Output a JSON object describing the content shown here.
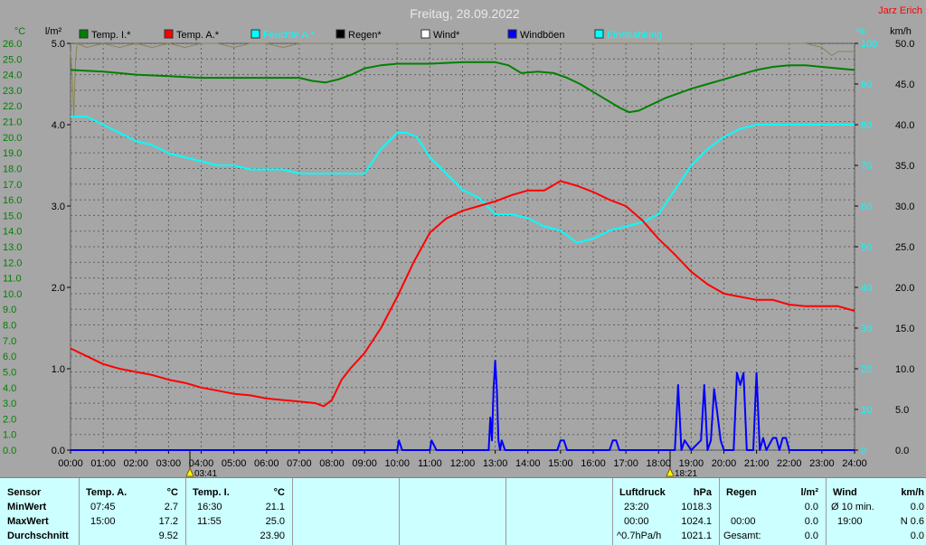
{
  "header": {
    "title": "Freitag, 28.09.2022",
    "author": "Jarz Erich"
  },
  "axes": {
    "left_temp_unit": "°C",
    "left_rain_unit": "l/m²",
    "right_hum_unit": "%",
    "right_wind_unit": "km/h",
    "temp_ticks": [
      "0.0",
      "1.0",
      "2.0",
      "3.0",
      "4.0",
      "5.0",
      "6.0",
      "7.0",
      "8.0",
      "9.0",
      "10.0",
      "11.0",
      "12.0",
      "13.0",
      "14.0",
      "15.0",
      "16.0",
      "17.0",
      "18.0",
      "19.0",
      "20.0",
      "21.0",
      "22.0",
      "23.0",
      "24.0",
      "25.0",
      "26.0"
    ],
    "rain_ticks": [
      "0.0",
      "1.0",
      "2.0",
      "3.0",
      "4.0",
      "5.0"
    ],
    "hum_ticks": [
      "0",
      "10",
      "20",
      "30",
      "40",
      "50",
      "60",
      "70",
      "80",
      "90",
      "100"
    ],
    "wind_ticks": [
      "0.0",
      "5.0",
      "10.0",
      "15.0",
      "20.0",
      "25.0",
      "30.0",
      "35.0",
      "40.0",
      "45.0",
      "50.0"
    ],
    "time_ticks": [
      "00:00",
      "01:00",
      "02:00",
      "03:00",
      "04:00",
      "05:00",
      "06:00",
      "07:00",
      "08:00",
      "09:00",
      "10:00",
      "11:00",
      "12:00",
      "13:00",
      "14:00",
      "15:00",
      "16:00",
      "17:00",
      "18:00",
      "19:00",
      "20:00",
      "21:00",
      "22:00",
      "23:00",
      "24:00"
    ],
    "sunrise": "03:41",
    "sunset": "18:21"
  },
  "legend": [
    {
      "label": "Temp. I.*",
      "color": "#008000"
    },
    {
      "label": "Temp. A.*",
      "color": "#ff0000"
    },
    {
      "label": "Feuchte A.*",
      "color": "#00ffff"
    },
    {
      "label": "Regen*",
      "color": "#000000"
    },
    {
      "label": "Wind*",
      "color": "#ffffff"
    },
    {
      "label": "Windböen",
      "color": "#0000ff"
    },
    {
      "label": "Einstrahlung",
      "color": "#00ffff"
    }
  ],
  "chart_data": {
    "type": "line",
    "title": "Freitag, 28.09.2022",
    "xlabel": "",
    "x_range": [
      0,
      24
    ],
    "temp_range": [
      0,
      26
    ],
    "rain_range": [
      0,
      5
    ],
    "hum_range": [
      0,
      100
    ],
    "wind_range": [
      0,
      50
    ],
    "grid": true,
    "legend_position": "top",
    "series": [
      {
        "name": "Temp. I.*",
        "axis": "temp",
        "color": "#008000",
        "x": [
          0,
          1,
          2,
          3,
          4,
          5,
          6,
          7,
          7.4,
          7.8,
          8.2,
          8.6,
          9,
          9.5,
          10,
          11,
          12,
          13,
          13.4,
          13.8,
          14.3,
          14.8,
          15.2,
          15.6,
          16,
          16.4,
          16.8,
          17.1,
          17.4,
          17.8,
          18.2,
          18.6,
          19,
          19.5,
          20,
          20.5,
          21,
          21.5,
          22,
          22.5,
          23,
          23.5,
          24
        ],
        "y": [
          24.3,
          24.2,
          24.0,
          23.9,
          23.8,
          23.8,
          23.8,
          23.8,
          23.6,
          23.5,
          23.7,
          24.0,
          24.4,
          24.6,
          24.7,
          24.7,
          24.8,
          24.8,
          24.6,
          24.1,
          24.2,
          24.1,
          23.8,
          23.4,
          22.9,
          22.4,
          21.9,
          21.6,
          21.7,
          22.1,
          22.5,
          22.8,
          23.1,
          23.4,
          23.7,
          24.0,
          24.3,
          24.5,
          24.6,
          24.6,
          24.5,
          24.4,
          24.3
        ]
      },
      {
        "name": "Temp. A.*",
        "axis": "temp",
        "color": "#ff0000",
        "x": [
          0,
          0.5,
          1,
          1.5,
          2,
          2.5,
          3,
          3.5,
          4,
          4.5,
          5,
          5.5,
          6,
          6.5,
          7,
          7.5,
          7.75,
          8,
          8.3,
          8.6,
          9,
          9.5,
          10,
          10.5,
          11,
          11.5,
          12,
          12.5,
          13,
          13.5,
          14,
          14.5,
          15,
          15.5,
          16,
          16.5,
          17,
          17.5,
          18,
          18.5,
          19,
          19.5,
          20,
          20.5,
          21,
          21.5,
          22,
          22.5,
          23,
          23.5,
          24
        ],
        "y": [
          6.5,
          6.0,
          5.5,
          5.2,
          5.0,
          4.8,
          4.5,
          4.3,
          4.0,
          3.8,
          3.6,
          3.5,
          3.3,
          3.2,
          3.1,
          3.0,
          2.8,
          3.2,
          4.5,
          5.3,
          6.2,
          7.8,
          9.8,
          12.0,
          13.9,
          14.8,
          15.3,
          15.6,
          15.9,
          16.3,
          16.6,
          16.6,
          17.2,
          16.9,
          16.5,
          16.0,
          15.6,
          14.7,
          13.5,
          12.5,
          11.4,
          10.6,
          10.0,
          9.8,
          9.6,
          9.6,
          9.3,
          9.2,
          9.2,
          9.2,
          8.9
        ]
      },
      {
        "name": "Feuchte A.*",
        "axis": "hum",
        "color": "#00ffff",
        "x": [
          0,
          0.5,
          1,
          1.5,
          2,
          2.5,
          3,
          3.5,
          4,
          4.5,
          5,
          5.5,
          6,
          6.5,
          7,
          7.5,
          8,
          8.5,
          9,
          9.5,
          10,
          10.3,
          10.6,
          11,
          11.5,
          12,
          12.5,
          13,
          13.5,
          14,
          14.5,
          15,
          15.5,
          16,
          16.5,
          17,
          17.5,
          18,
          18.5,
          19,
          19.5,
          20,
          20.5,
          21,
          21.5,
          22,
          22.5,
          23,
          23.5,
          24
        ],
        "y": [
          82,
          82,
          80,
          78,
          76,
          75,
          73,
          72,
          71,
          70,
          70,
          69,
          69,
          69,
          68,
          68,
          68,
          68,
          68,
          74,
          78,
          78,
          77,
          72,
          68,
          64,
          62,
          58,
          58,
          57,
          55,
          54,
          51,
          52,
          54,
          55,
          56,
          58,
          64,
          70,
          74,
          77,
          79,
          80,
          80,
          80,
          80,
          80,
          80,
          80
        ]
      },
      {
        "name": "Einstrahlung",
        "axis": "hum",
        "color": "#8b8452",
        "x": [
          0,
          0.05,
          0.1,
          0.15,
          0.2,
          0.5,
          1,
          1.5,
          2,
          2.5,
          3,
          3.5,
          4,
          4.5,
          5,
          5.5,
          6,
          6.5,
          7,
          7.5,
          8,
          8.5,
          9,
          9.5,
          10,
          10.5,
          11,
          11.5,
          12,
          12.5,
          13,
          13.5,
          14,
          14.5,
          15,
          15.5,
          16,
          16.5,
          17,
          17.5,
          18,
          18.5,
          19,
          19.5,
          20,
          20.5,
          21,
          21.5,
          22,
          22.5,
          23,
          23.3,
          23.5,
          24
        ],
        "y": [
          98,
          92,
          82,
          95,
          100,
          99,
          100,
          99,
          100,
          99,
          100,
          99,
          100,
          100,
          99,
          100,
          100,
          99,
          100,
          100,
          100,
          100,
          100,
          100,
          100,
          100,
          100,
          100,
          100,
          100,
          100,
          100,
          100,
          100,
          100,
          100,
          100,
          100,
          100,
          100,
          100,
          100,
          100,
          100,
          100,
          100,
          100,
          100,
          100,
          100,
          99,
          97,
          98,
          98
        ]
      },
      {
        "name": "Windböen",
        "axis": "wind",
        "color": "#0000ff",
        "x": [
          0,
          10,
          10.05,
          10.15,
          11,
          11.05,
          11.2,
          12.8,
          12.85,
          12.9,
          12.95,
          13.0,
          13.05,
          13.1,
          13.15,
          13.2,
          13.3,
          14.9,
          15.0,
          15.1,
          15.2,
          16.5,
          16.6,
          16.7,
          16.8,
          18.5,
          18.6,
          18.7,
          18.8,
          19.0,
          19.3,
          19.4,
          19.5,
          19.6,
          19.7,
          19.8,
          19.9,
          20.0,
          20.1,
          20.3,
          20.4,
          20.5,
          20.6,
          20.7,
          20.8,
          20.9,
          21.0,
          21.1,
          21.2,
          21.3,
          21.5,
          21.6,
          21.7,
          21.8,
          21.9,
          22.0,
          24
        ],
        "y": [
          0,
          0,
          1.2,
          0,
          0,
          1.2,
          0,
          0,
          4.0,
          1.2,
          7.5,
          11.0,
          7.5,
          1.2,
          0,
          1.2,
          0,
          0,
          1.2,
          1.2,
          0,
          0,
          1.2,
          1.2,
          0,
          0,
          8.0,
          0,
          1.2,
          0,
          1.2,
          8.0,
          0,
          1.2,
          7.5,
          4.5,
          1.2,
          0,
          0,
          0,
          9.5,
          8.0,
          9.5,
          0,
          0,
          0,
          9.5,
          0,
          1.5,
          0,
          1.5,
          1.5,
          0,
          1.5,
          1.5,
          0,
          0
        ]
      }
    ]
  },
  "stats": {
    "sensor": {
      "header": "Sensor",
      "rows": [
        "MinWert",
        "MaxWert",
        "Durchschnitt"
      ]
    },
    "temp_a": {
      "header": "Temp. A.",
      "unit": "°C",
      "min_time": "07:45",
      "min_val": "2.7",
      "max_time": "15:00",
      "max_val": "17.2",
      "avg_val": "9.52"
    },
    "temp_i": {
      "header": "Temp. I.",
      "unit": "°C",
      "min_time": "16:30",
      "min_val": "21.1",
      "max_time": "11:55",
      "max_val": "25.0",
      "avg_val": "23.90"
    },
    "pressure": {
      "header": "Luftdruck",
      "unit": "hPa",
      "min_time": "23:20",
      "min_val": "1018.3",
      "max_time": "00:00",
      "max_val": "1024.1",
      "trend": "^0.7hPa/h",
      "avg_val": "1021.1"
    },
    "rain": {
      "header": "Regen",
      "unit": "l/m²",
      "max_time": "00:00",
      "max_val": "0.0",
      "min_val": "0.0",
      "total_label": "Gesamt:",
      "total_val": "0.0"
    },
    "wind": {
      "header": "Wind",
      "unit": "km/h",
      "label": "Ø 10 min.",
      "val": "0.0",
      "time": "19:00",
      "dir_val": "N 0.6",
      "avg_val": "0.0"
    }
  }
}
